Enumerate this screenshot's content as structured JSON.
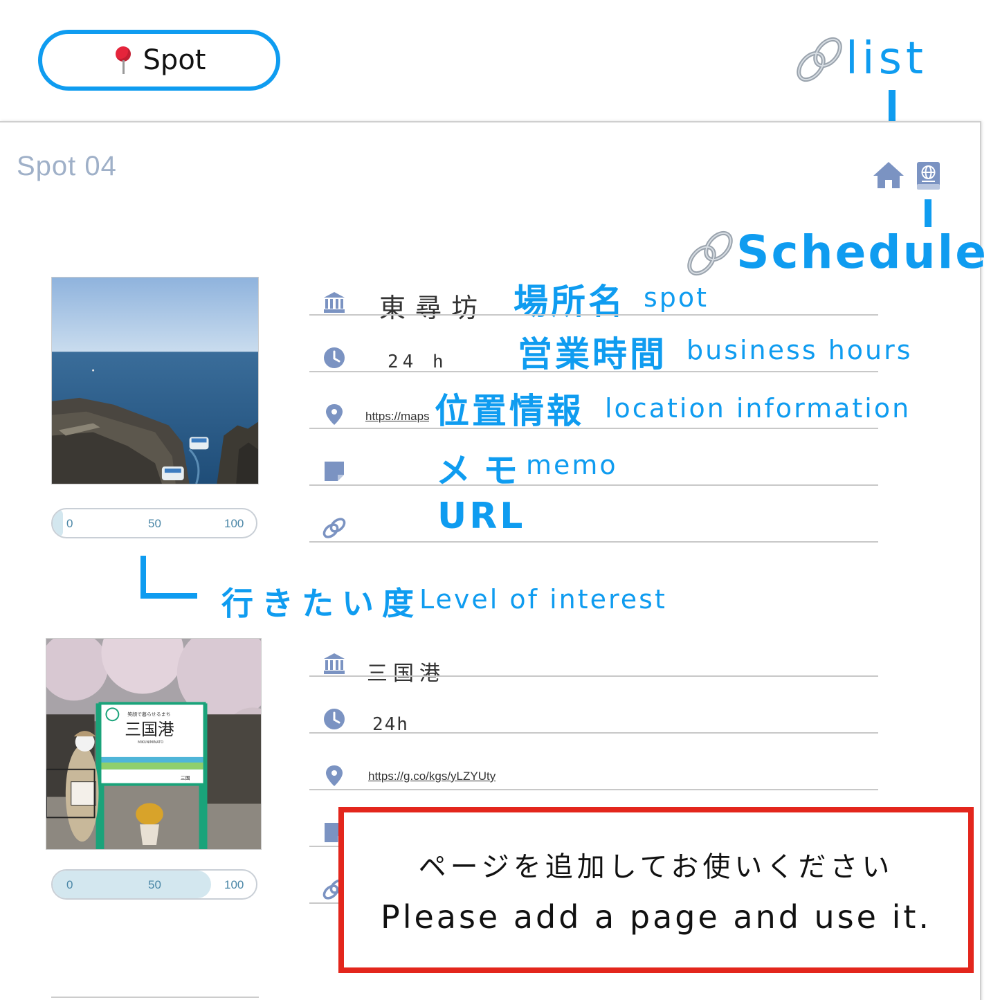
{
  "header": {
    "spot_button_label": "Spot",
    "list_link_label": "list",
    "schedule_link_label": "Schedule"
  },
  "sheet": {
    "title": "Spot 04"
  },
  "annotations": {
    "spot_jp": "場所名",
    "spot_en": "spot",
    "hours_jp": "営業時間",
    "hours_en": "business hours",
    "location_jp": "位置情報",
    "location_en": "location information",
    "memo_jp": "メモ",
    "memo_en": "memo",
    "url": "URL",
    "interest_jp": "行きたい度",
    "interest_en": "Level of interest"
  },
  "entries": [
    {
      "name": "東尋坊",
      "hours": "24 h",
      "location": "https://maps",
      "interest": 0.05,
      "slider_ticks": [
        "0",
        "50",
        "100"
      ]
    },
    {
      "name": "三国港",
      "hours": "24h",
      "location": "https://g.co/kgs/yLZYUty",
      "interest": 0.78,
      "slider_ticks": [
        "0",
        "50",
        "100"
      ],
      "photo_sign": {
        "top": "笑顔で暮らせるまち",
        "main": "三国港",
        "romaji": "MIKUNIMINATO",
        "next": "三国"
      }
    }
  ],
  "notice": {
    "jp": "ページを追加してお使いください",
    "en": "Please add a page and use it."
  },
  "colors": {
    "accent": "#0f9cf0",
    "notice_border": "#e3261c",
    "icon": "#7b93c2",
    "slider_fill": "#d3e7ef"
  },
  "icons": [
    "map-pin-icon",
    "chain-link-icon",
    "home-icon",
    "globe-book-icon",
    "building-icon",
    "clock-icon",
    "location-pin-icon",
    "memo-note-icon",
    "link-icon"
  ]
}
